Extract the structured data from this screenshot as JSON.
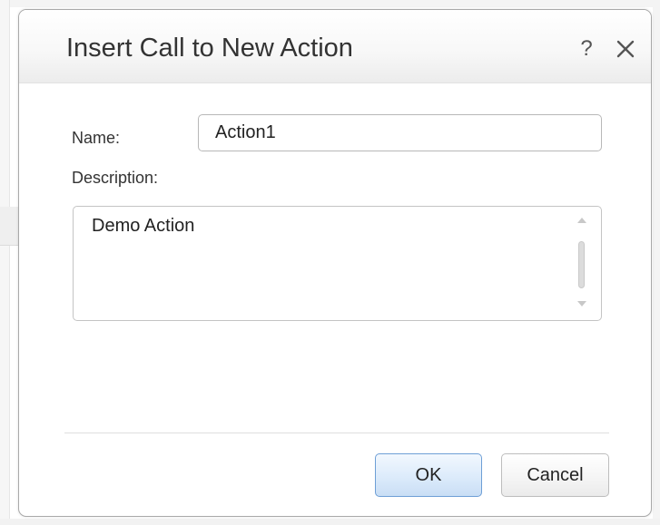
{
  "dialog": {
    "title": "Insert Call to New Action",
    "help_symbol": "?",
    "name_label": "Name:",
    "name_value": "Action1",
    "description_label": "Description:",
    "description_value": "Demo Action",
    "ok_label": "OK",
    "cancel_label": "Cancel"
  },
  "icons": {
    "help": "help-icon",
    "close": "close-icon"
  },
  "colors": {
    "ok_border": "#6e9fd6",
    "ok_fill": "#dcebfb"
  }
}
